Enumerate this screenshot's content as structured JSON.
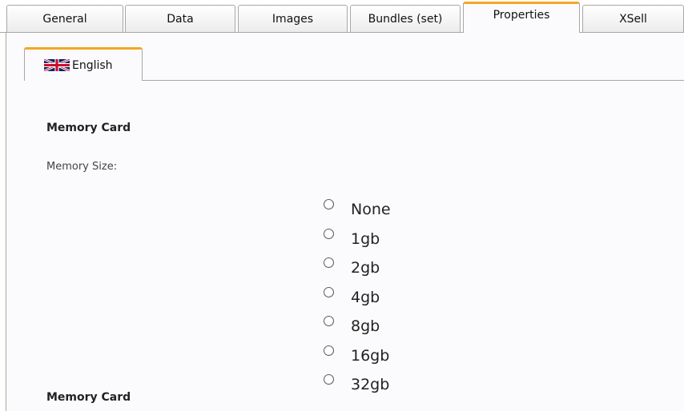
{
  "tabs": [
    {
      "label": "General",
      "active": false
    },
    {
      "label": "Data",
      "active": false
    },
    {
      "label": "Images",
      "active": false
    },
    {
      "label": "Bundles (set)",
      "active": false
    },
    {
      "label": "Properties",
      "active": true
    },
    {
      "label": "XSell",
      "active": false
    }
  ],
  "language_tab": {
    "label": "English",
    "flag_icon": "uk-flag-icon"
  },
  "sections": [
    {
      "title": "Memory Card",
      "field_label": "Memory Size:",
      "options": [
        "None",
        "1gb",
        "2gb",
        "4gb",
        "8gb",
        "16gb",
        "32gb"
      ],
      "selected": null
    },
    {
      "title": "Memory Card"
    }
  ],
  "colors": {
    "active_tab_accent": "#f5a623",
    "border": "#a7a7a7",
    "panel_bg": "#fbfbfd"
  }
}
